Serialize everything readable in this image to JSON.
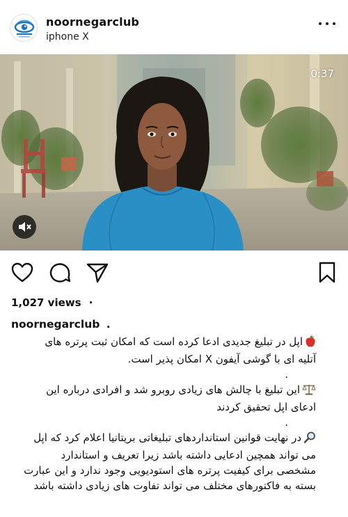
{
  "post": {
    "username": "noornegarclub",
    "location": "iphone X",
    "avatar_icon": "eye-logo-icon",
    "avatar_color": "#1e73be"
  },
  "video": {
    "time_remaining": "0:37",
    "mute_icon": "speaker-muted-icon"
  },
  "actions": {
    "like_icon": "heart-icon",
    "comment_icon": "comment-bubble-icon",
    "share_icon": "paper-plane-icon",
    "save_icon": "bookmark-icon"
  },
  "stats": {
    "views": "1,027 views",
    "views_dot": "·"
  },
  "caption": {
    "username": "noornegarclub",
    "trailing_dot": ".",
    "paragraphs": [
      {
        "emoji": "apple-icon",
        "text": "اپل در تبلیغ جدیدی ادعا کرده است که امکان ثبت پرتره های آتلیه ای با گوشی آیفون X امکان پذیر است."
      },
      {
        "emoji": "scales-icon",
        "text": "این تبلیغ با چالش های زیادی روبرو شد و افرادی درباره این ادعای اپل تحقیق کردند"
      },
      {
        "emoji": "magnifier-icon",
        "text": "در نهایت قوانین استانداردهای تبلیغاتی بریتانیا اعلام کرد که اپل می تواند همچین ادعایی داشته باشد زیرا تعریف و استاندارد مشخصی برای کیفیت پرتره های استودیویی وجود ندارد و این عبارت بسته به فاکتورهای مختلف می تواند تفاوت های زیادی داشته باشد"
      }
    ],
    "separator": "."
  },
  "colors": {
    "text": "#111111",
    "accent_blue": "#1e73be",
    "shirt_blue": "#2a8fc4"
  }
}
